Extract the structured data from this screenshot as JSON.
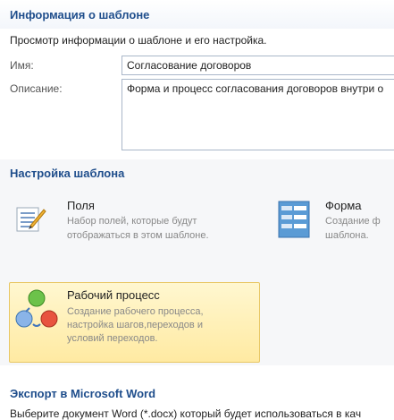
{
  "info": {
    "title": "Информация о шаблоне",
    "description": "Просмотр информации о шаблоне и его настройка.",
    "name_label": "Имя:",
    "name_value": "Согласование договоров",
    "desc_label": "Описание:",
    "desc_value": "Форма и процесс согласования договоров внутри о"
  },
  "settings": {
    "title": "Настройка шаблона",
    "tiles": [
      {
        "title": "Поля",
        "text1": "Набор полей, которые будут",
        "text2": "отображаться в этом шаблоне.",
        "icon": "fields-icon"
      },
      {
        "title": "Форма",
        "text1": "Создание ф",
        "text2": "шаблона.",
        "icon": "form-icon"
      },
      {
        "title": "Рабочий процесс",
        "text1": "Создание рабочего процесса,",
        "text2": "настройка шагов,переходов и",
        "text3": "условий переходов.",
        "icon": "workflow-icon"
      }
    ]
  },
  "export": {
    "title": "Экспорт в Microsoft Word",
    "description": "Выберите документ Word (*.docx) который будет использоваться в кач"
  },
  "colors": {
    "section_title": "#1f4e8c",
    "highlight_bg": "#ffeaa2",
    "highlight_border": "#e8c765"
  }
}
